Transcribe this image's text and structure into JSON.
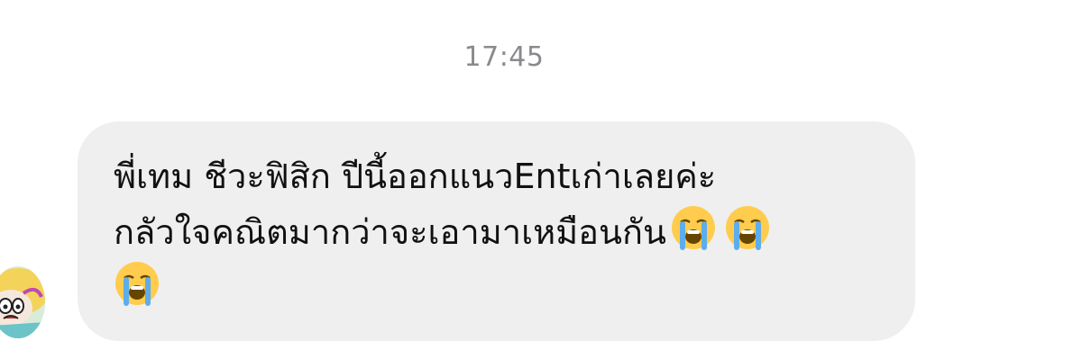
{
  "chat": {
    "timestamp": "17:45",
    "message": {
      "line1": "พี่เทม ชีวะฟิสิก ปีนี้ออกแนวEntเก่าเลยค่ะ",
      "line2": "กลัวใจคณิตมากว่าจะเอามาเหมือนกัน",
      "emoji": "loudly-crying-face-icon",
      "emoji_count": 3
    },
    "sender": {
      "avatar": "cartoon-avatar"
    }
  },
  "colors": {
    "bubble": "#efefef",
    "timestamp": "#8a8a8e",
    "text": "#111111"
  }
}
